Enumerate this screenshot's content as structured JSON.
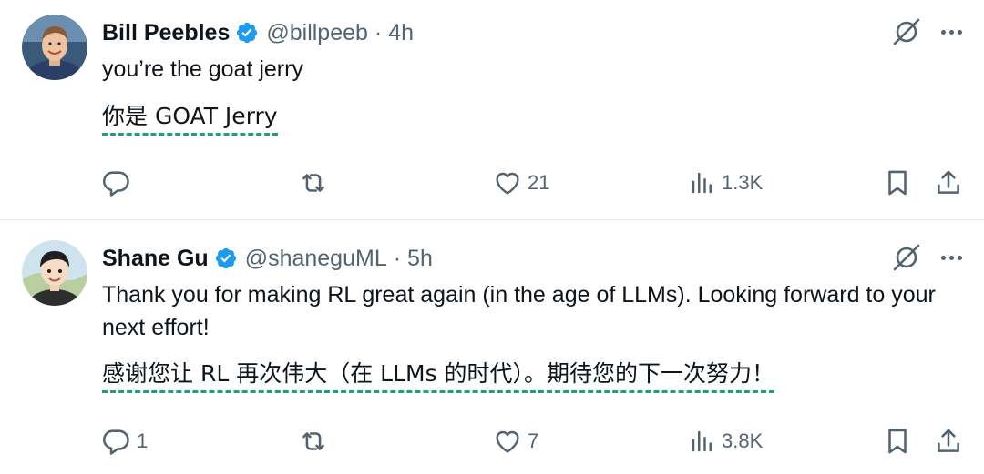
{
  "tweets": [
    {
      "name": "Bill Peebles",
      "handle": "@billpeeb",
      "separator": "·",
      "time": "4h",
      "text": "you’re the goat jerry",
      "translation": "你是 GOAT Jerry",
      "reply_count": "",
      "retweet_count": "",
      "like_count": "21",
      "view_count": "1.3K"
    },
    {
      "name": "Shane Gu",
      "handle": "@shaneguML",
      "separator": "·",
      "time": "5h",
      "text": "Thank you for making RL great again (in the age of LLMs). Looking forward to your next effort!",
      "translation": "感谢您让 RL 再次伟大（在 LLMs 的时代）。期待您的下一次努力！",
      "reply_count": "1",
      "retweet_count": "",
      "like_count": "7",
      "view_count": "3.8K"
    }
  ],
  "colors": {
    "verified": "#1d9bf0",
    "secondary_text": "#536471",
    "translation_underline": "#1aa37a",
    "divider": "#e6e9ea"
  },
  "icons": [
    "verified-badge-icon",
    "grok-icon",
    "more-icon",
    "reply-icon",
    "retweet-icon",
    "like-icon",
    "views-icon",
    "bookmark-icon",
    "share-icon"
  ]
}
